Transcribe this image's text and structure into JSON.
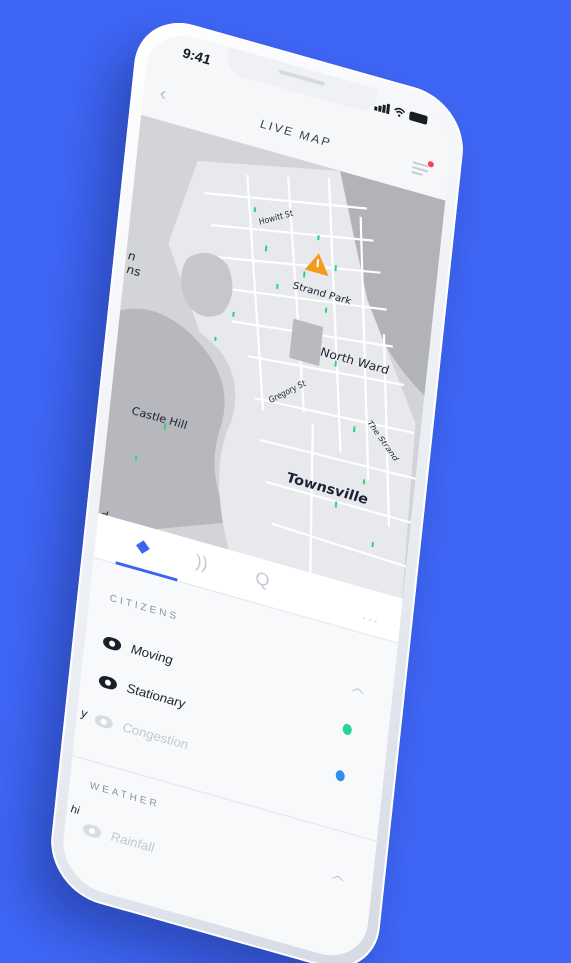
{
  "status": {
    "time": "9:41"
  },
  "header": {
    "title": "LIVE MAP"
  },
  "map": {
    "labels": {
      "howitt": "Howitt St",
      "strand_park": "Strand Park",
      "north_ward": "North Ward",
      "gregory": "Gregory St",
      "the_strand": "The Strand",
      "castle_hill": "Castle Hill",
      "townsville": "Townsville",
      "edge_n": "n",
      "edge_ns": "ns",
      "edge_d": "d"
    }
  },
  "panel": {
    "tabs": [
      {
        "name": "layers-icon"
      },
      {
        "name": "signal-icon"
      },
      {
        "name": "search-icon"
      }
    ],
    "more_label": "...",
    "citizens": {
      "title": "CITIZENS",
      "items": [
        {
          "label": "Moving",
          "color": "#22d39a"
        },
        {
          "label": "Stationary",
          "color": "#2f8cf0"
        },
        {
          "label": "Congestion"
        }
      ]
    },
    "weather": {
      "title": "WEATHER",
      "items": [
        {
          "label": "Rainfall"
        }
      ]
    },
    "edge_labels": {
      "y": "y",
      "hi": "hi"
    }
  },
  "colors": {
    "background": "#3f66f6",
    "accent": "#3d63f3",
    "alert": "#f39b1e"
  }
}
